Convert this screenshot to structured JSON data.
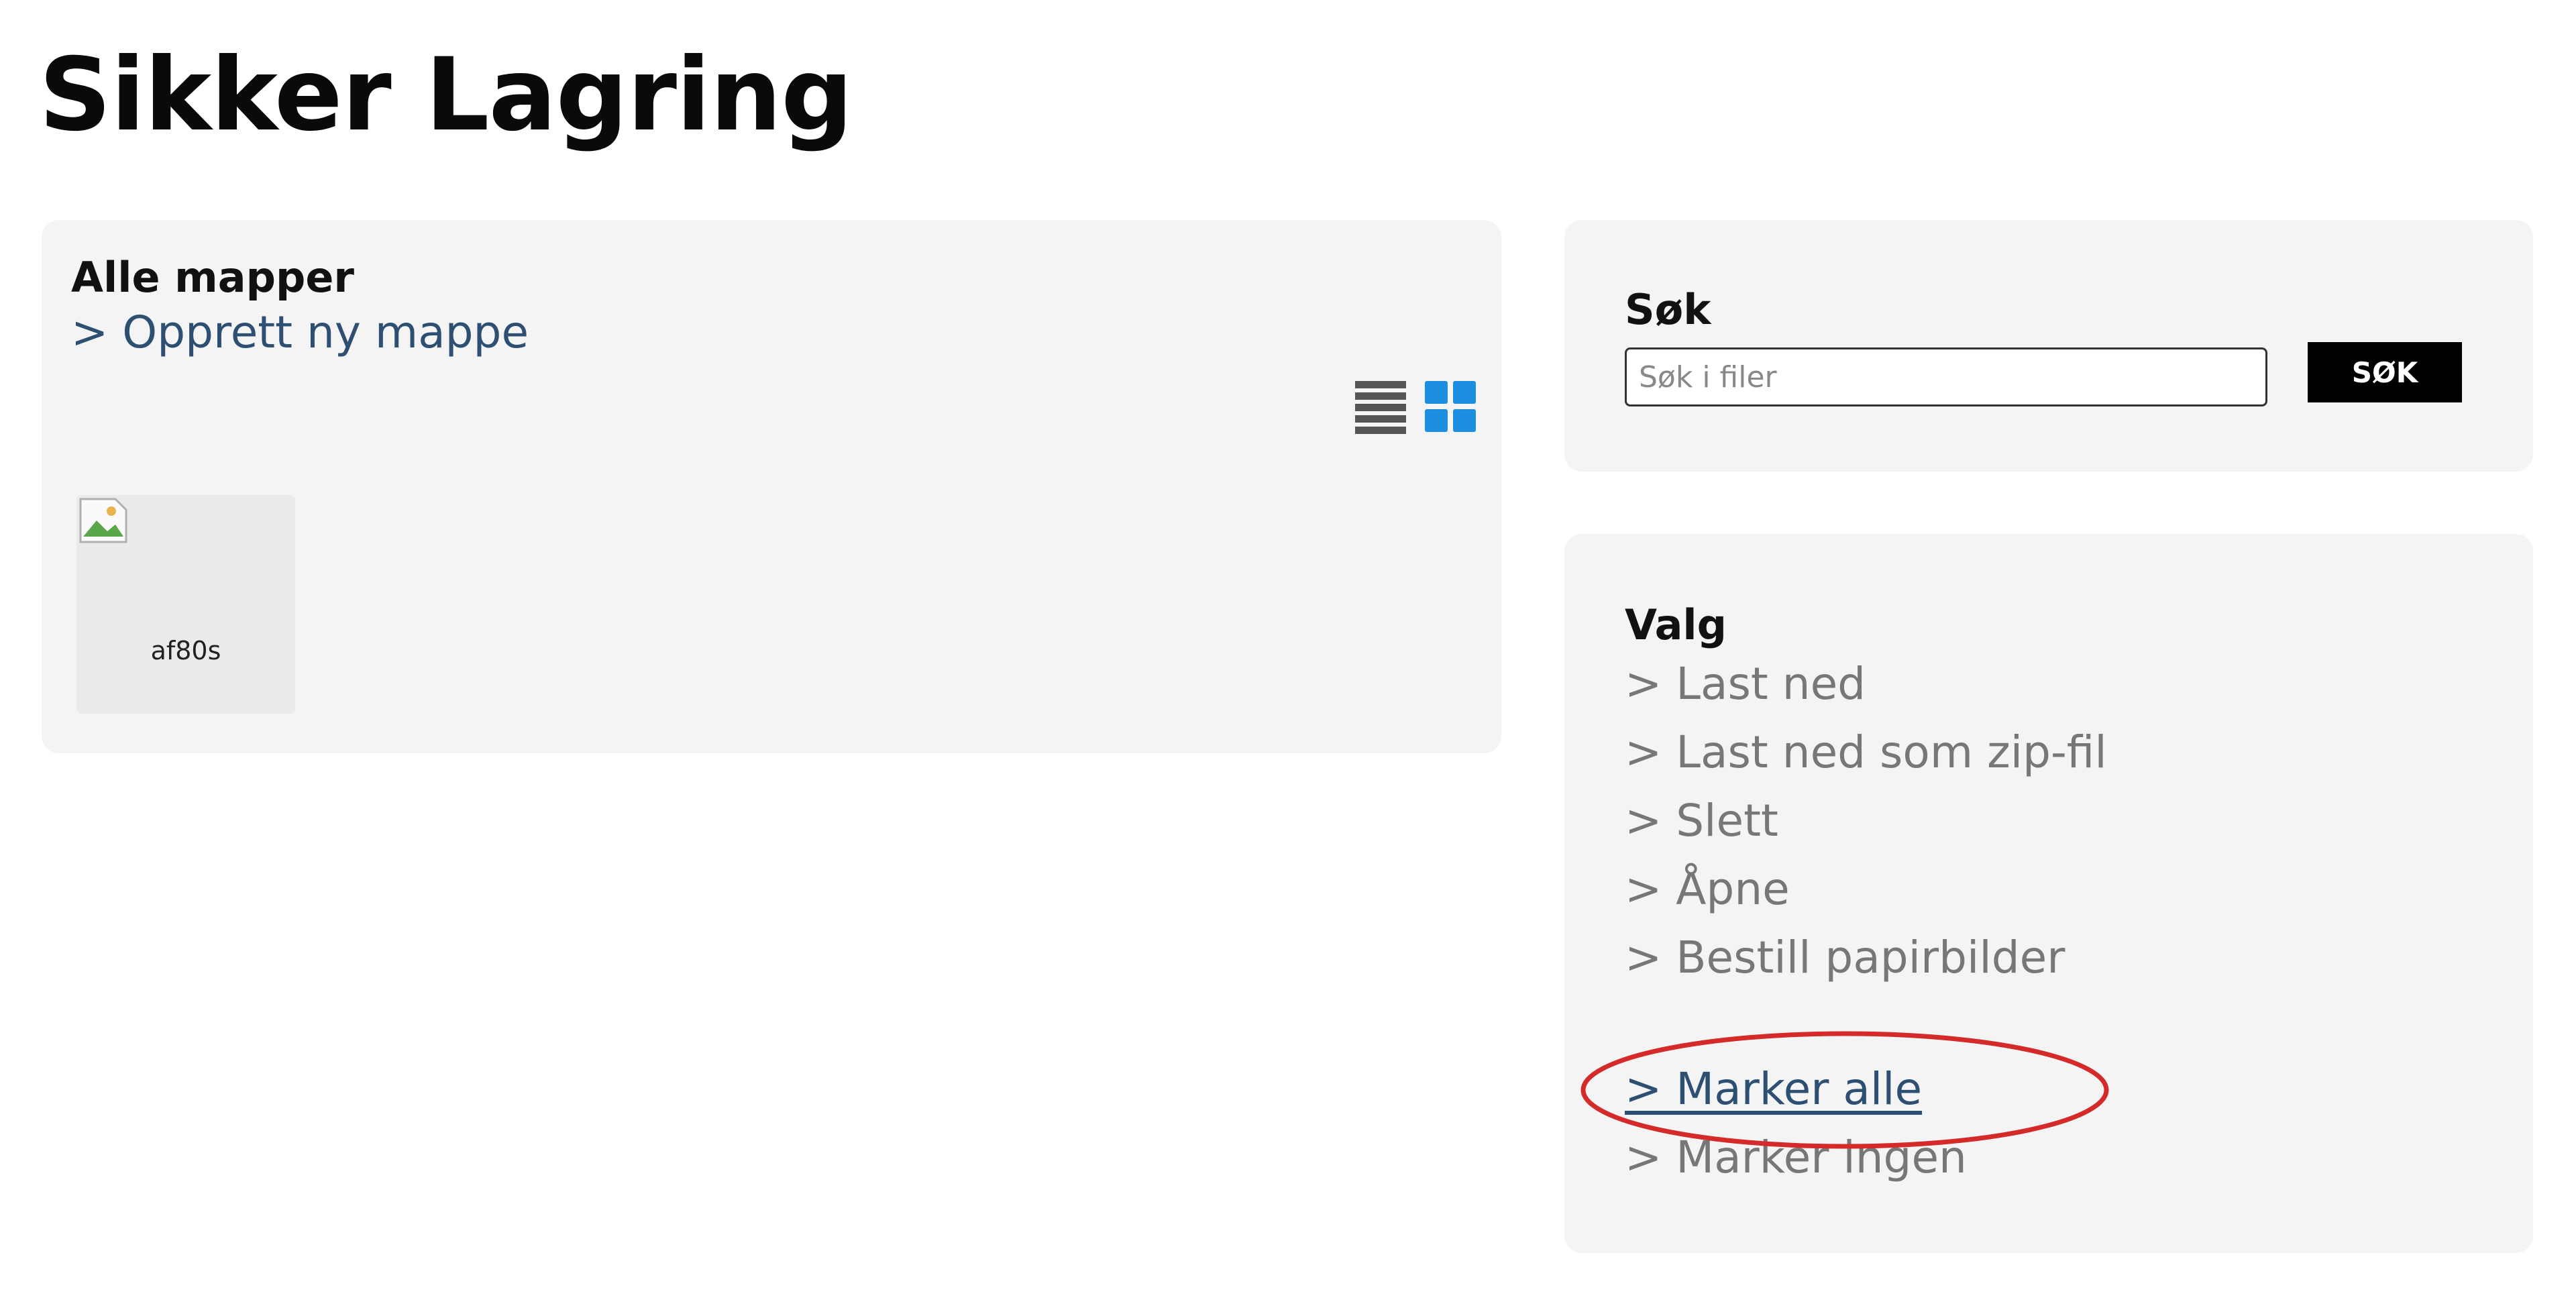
{
  "page": {
    "title": "Sikker Lagring"
  },
  "folders_panel": {
    "heading": "Alle mapper",
    "create_folder_link": "> Opprett ny mappe",
    "view_modes": [
      {
        "icon": "list-view-icon",
        "active": false
      },
      {
        "icon": "grid-view-icon",
        "active": true
      }
    ],
    "items": [
      {
        "icon": "broken-image-icon",
        "label": "af80s"
      }
    ]
  },
  "search_panel": {
    "heading": "Søk",
    "input_placeholder": "Søk i filer",
    "input_value": "",
    "button_label": "SØK"
  },
  "options_panel": {
    "heading": "Valg",
    "actions": [
      {
        "label": "> Last ned",
        "enabled": false
      },
      {
        "label": "> Last ned som zip-fil",
        "enabled": false
      },
      {
        "label": "> Slett",
        "enabled": false
      },
      {
        "label": "> Åpne",
        "enabled": false
      },
      {
        "label": "> Bestill papirbilder",
        "enabled": false
      }
    ],
    "select_all_link": "> Marker alle",
    "select_none_link": "> Marker ingen"
  },
  "colors": {
    "panel_background": "#f4f4f4",
    "link_blue": "#2d4f72",
    "link_disabled": "#777777",
    "grid_icon_active": "#1e8fe0",
    "annotation_red": "#d42a2a"
  }
}
